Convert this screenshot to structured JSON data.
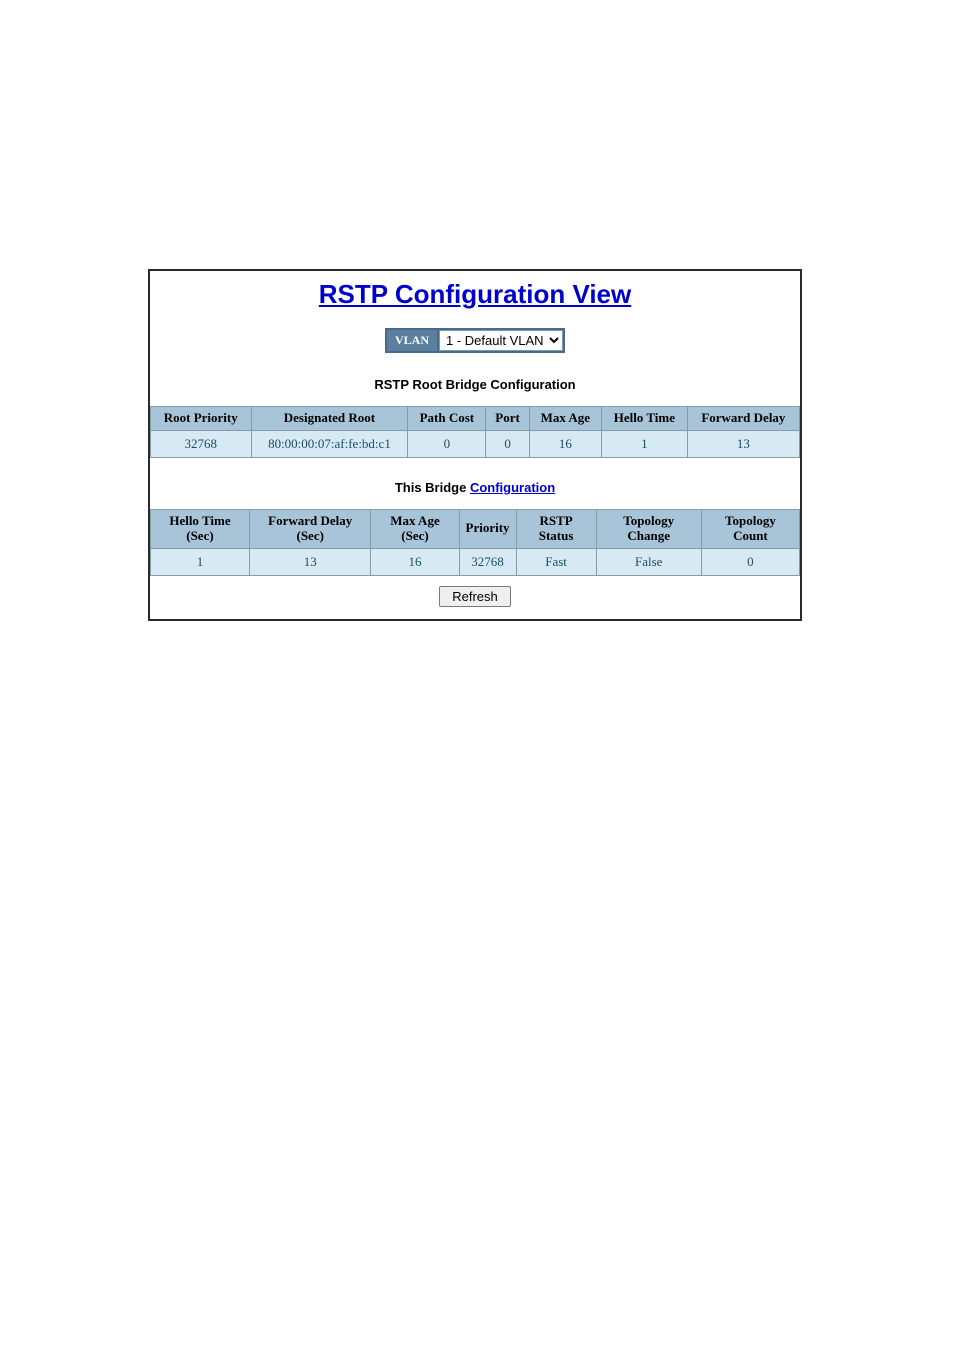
{
  "title": "RSTP Configuration View",
  "vlan": {
    "label": "VLAN",
    "selected": "1 - Default VLAN"
  },
  "root_section": {
    "heading": "RSTP Root Bridge Configuration",
    "headers": [
      "Root Priority",
      "Designated Root",
      "Path Cost",
      "Port",
      "Max Age",
      "Hello Time",
      "Forward Delay"
    ],
    "row": {
      "root_priority": "32768",
      "designated_root": "80:00:00:07:af:fe:bd:c1",
      "path_cost": "0",
      "port": "0",
      "max_age": "16",
      "hello_time": "1",
      "forward_delay": "13"
    }
  },
  "bridge_section": {
    "heading_prefix": "This Bridge ",
    "heading_link": "Configuration",
    "headers": {
      "hello_time": "Hello Time (Sec)",
      "forward_delay": "Forward Delay (Sec)",
      "max_age": "Max Age (Sec)",
      "priority": "Priority",
      "rstp_status": "RSTP Status",
      "topology_change": "Topology Change",
      "topology_count": "Topology Count"
    },
    "row": {
      "hello_time": "1",
      "forward_delay": "13",
      "max_age": "16",
      "priority": "32768",
      "rstp_status": "Fast",
      "topology_change": "False",
      "topology_count": "0"
    }
  },
  "refresh_label": "Refresh"
}
